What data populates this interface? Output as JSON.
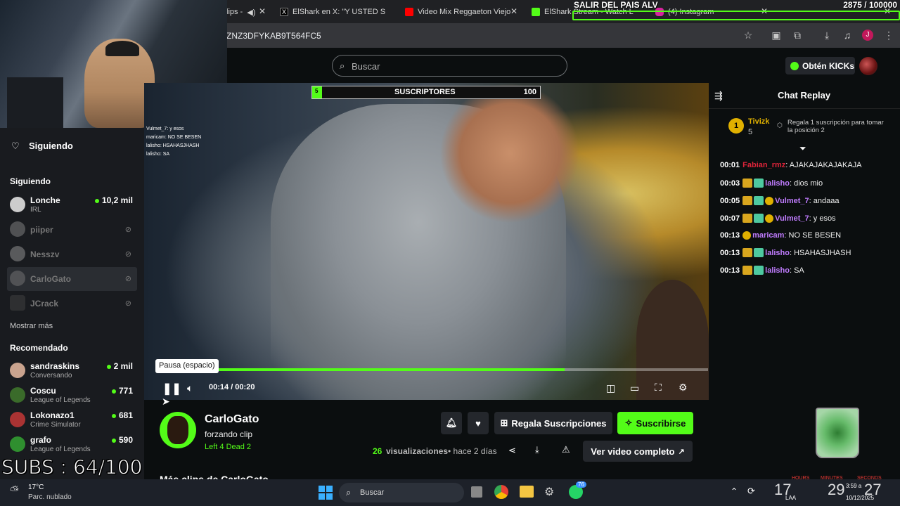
{
  "browser": {
    "tabs": [
      {
        "label": "lips -",
        "color": "#53fc18"
      },
      {
        "label": "ElShark en X: \"Y USTED SINTI",
        "color": "#000000"
      },
      {
        "label": "Video Mix Reggaeton Viejo",
        "color": "#ff0000"
      },
      {
        "label": "ElShark Stream - Watch Live",
        "color": "#53fc18"
      },
      {
        "label": "(4) Instagram",
        "color": "#d6249f"
      }
    ],
    "url": "ZNZ3DFYKAB9T564FC5"
  },
  "overlay": {
    "goal_title": "SALIR DEL PAIS ALV",
    "goal_count": "2875 / 100000",
    "subgoal_label": "SUSCRIPTORES",
    "subgoal_left": "5",
    "subgoal_right": "100",
    "subs_counter": "SUBS : 64/100",
    "mini_chat": [
      "Vulmet_7: y esos",
      "maricam: NO SE BESEN",
      "lalisho: HSAHASJHASH",
      "lalisho: SA"
    ]
  },
  "kick": {
    "search_placeholder": "Buscar",
    "kicks_button": "Obtén KICKs",
    "following_header": "Siguiendo",
    "following_section": "Siguiendo",
    "show_more": "Mostrar más",
    "recommended_section": "Recomendado",
    "following": [
      {
        "name": "Lonche",
        "category": "IRL",
        "viewers": "10,2 mil",
        "live": true
      },
      {
        "name": "piiper",
        "live": false
      },
      {
        "name": "Nesszv",
        "live": false
      },
      {
        "name": "CarloGato",
        "live": false
      },
      {
        "name": "JCrack",
        "live": false
      }
    ],
    "recommended": [
      {
        "name": "sandraskins",
        "category": "Conversando",
        "viewers": "2 mil"
      },
      {
        "name": "Coscu",
        "category": "League of Legends",
        "viewers": "771"
      },
      {
        "name": "Lokonazo1",
        "category": "Crime Simulator",
        "viewers": "681"
      },
      {
        "name": "grafo",
        "category": "League of Legends",
        "viewers": "590"
      }
    ]
  },
  "player": {
    "tooltip": "Pausa (espacio)",
    "time": "00:14 / 00:20",
    "progress": 0.74
  },
  "clip": {
    "channel": "CarloGato",
    "title": "forzando clip",
    "category": "Left 4 Dead 2",
    "gift_button": "Regala Suscripciones",
    "subscribe_button": "Suscribirse",
    "views_count": "26",
    "views_label": "visualizaciones",
    "age": "• hace 2 días",
    "full_video_button": "Ver video completo",
    "more_clips": "Más clips de CarloGato"
  },
  "chat": {
    "title": "Chat Replay",
    "top_gifter": "Tivizk",
    "top_gifter_count": "5",
    "gift_prompt": "Regala 1 suscripción para tomar la posición 2",
    "messages": [
      {
        "time": "00:01",
        "user": "Fabian_rmz",
        "text": ": AJAKAJAKAJAKAJA",
        "color": "#e0243a",
        "badges": []
      },
      {
        "time": "00:03",
        "user": "lalisho",
        "text": ": dios mio",
        "color": "#c07cff",
        "badges": [
          "crown",
          "sub"
        ]
      },
      {
        "time": "00:05",
        "user": "Vulmet_7",
        "text": ": andaaa",
        "color": "#c07cff",
        "badges": [
          "crown",
          "sub",
          "gold"
        ]
      },
      {
        "time": "00:07",
        "user": "Vulmet_7",
        "text": ": y esos",
        "color": "#c07cff",
        "badges": [
          "crown",
          "sub",
          "gold"
        ]
      },
      {
        "time": "00:13",
        "user": "maricam",
        "text": ": NO SE BESEN",
        "color": "#c07cff",
        "badges": [
          "gold"
        ]
      },
      {
        "time": "00:13",
        "user": "lalisho",
        "text": ": HSAHASJHASH",
        "color": "#c07cff",
        "badges": [
          "crown",
          "sub"
        ]
      },
      {
        "time": "00:13",
        "user": "lalisho",
        "text": ": SA",
        "color": "#c07cff",
        "badges": [
          "crown",
          "sub"
        ]
      }
    ]
  },
  "taskbar": {
    "temperature": "17°C",
    "weather": "Parc. nublado",
    "search": "Buscar",
    "whatsapp_badge": "76",
    "lang": "LAA",
    "time": "3:59 a",
    "date": "10/12/2025",
    "clock_hours": "17",
    "clock_minutes": "29",
    "clock_seconds": "27",
    "clock_labels": [
      "HOURS",
      "MINUTES",
      "SECONDS"
    ]
  }
}
